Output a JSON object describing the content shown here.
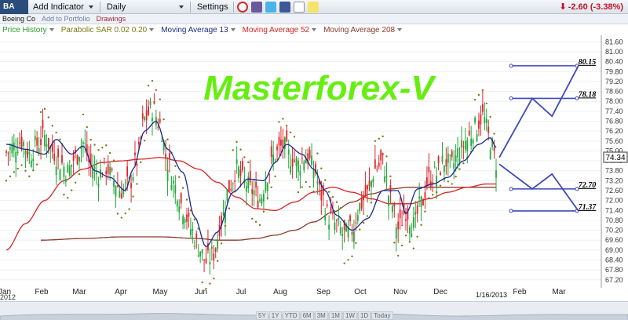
{
  "toolbar": {
    "symbol": "BA",
    "add_indicator": "Add Indicator",
    "interval": "Daily",
    "settings": "Settings",
    "change": "-2.60 (-3.38%)",
    "change_color": "#c0152a",
    "icons": [
      "alarm-clock-icon",
      "document-icon",
      "twitter-icon",
      "facebook-icon",
      "email-icon",
      "note-icon"
    ]
  },
  "subbar": {
    "company": "Boeing Co",
    "add_portfolio": "Add to Portfolio",
    "drawings": "Drawings"
  },
  "legend": [
    {
      "label": "Price History",
      "color": "#2a9a2a"
    },
    {
      "label": "Parabolic SAR 0.02 0.20",
      "color": "#7a7a14"
    },
    {
      "label": "Moving Average 13",
      "color": "#1a2a8a"
    },
    {
      "label": "Moving Average 52",
      "color": "#d62222"
    },
    {
      "label": "Moving Average 208",
      "color": "#8a3a2a"
    }
  ],
  "chart_data": {
    "type": "line",
    "title": "Masterforex-V",
    "title_color": "#66ee11",
    "x_ticks": [
      "Jan",
      "Feb",
      "Mar",
      "Apr",
      "May",
      "Jun",
      "Jul",
      "Aug",
      "Sep",
      "Oct",
      "Nov",
      "Dec",
      "Feb",
      "Mar"
    ],
    "x_year_label": "2012",
    "date_label": "1/16/2013",
    "y_ticks": [
      "81.60",
      "81.00",
      "80.40",
      "79.80",
      "79.20",
      "78.60",
      "78.00",
      "77.40",
      "76.80",
      "76.20",
      "75.60",
      "75.00",
      "74.40",
      "73.80",
      "73.20",
      "72.60",
      "72.00",
      "71.40",
      "70.80",
      "70.20",
      "69.60",
      "69.00",
      "68.40",
      "67.80",
      "67.20"
    ],
    "ylim": [
      67.0,
      81.9
    ],
    "last_price": "74.34",
    "levels": [
      {
        "value": 80.15,
        "label": "80.15"
      },
      {
        "value": 78.18,
        "label": "78.18"
      },
      {
        "value": 72.7,
        "label": "72.70"
      },
      {
        "value": 71.37,
        "label": "71.37"
      }
    ],
    "price_anchors": [
      [
        0,
        74.9
      ],
      [
        4,
        75.3
      ],
      [
        8,
        75.6
      ],
      [
        12,
        74.8
      ],
      [
        16,
        75.4
      ],
      [
        20,
        75.9
      ],
      [
        24,
        75.0
      ],
      [
        28,
        74.3
      ],
      [
        32,
        73.8
      ],
      [
        36,
        74.6
      ],
      [
        40,
        75.5
      ],
      [
        44,
        74.1
      ],
      [
        48,
        73.6
      ],
      [
        52,
        74.0
      ],
      [
        56,
        73.2
      ],
      [
        60,
        72.6
      ],
      [
        64,
        73.0
      ],
      [
        68,
        74.4
      ],
      [
        72,
        76.9
      ],
      [
        76,
        77.6
      ],
      [
        80,
        76.6
      ],
      [
        84,
        74.3
      ],
      [
        88,
        72.8
      ],
      [
        92,
        71.6
      ],
      [
        96,
        70.3
      ],
      [
        100,
        69.2
      ],
      [
        104,
        68.3
      ],
      [
        108,
        68.8
      ],
      [
        112,
        70.8
      ],
      [
        116,
        72.8
      ],
      [
        120,
        73.9
      ],
      [
        124,
        73.1
      ],
      [
        128,
        72.6
      ],
      [
        132,
        72.1
      ],
      [
        136,
        73.6
      ],
      [
        140,
        74.8
      ],
      [
        144,
        75.3
      ],
      [
        148,
        74.6
      ],
      [
        152,
        74.2
      ],
      [
        156,
        74.7
      ],
      [
        160,
        74.0
      ],
      [
        164,
        72.3
      ],
      [
        168,
        71.0
      ],
      [
        172,
        70.5
      ],
      [
        176,
        69.9
      ],
      [
        180,
        70.2
      ],
      [
        184,
        71.7
      ],
      [
        188,
        72.4
      ],
      [
        192,
        73.9
      ],
      [
        196,
        74.3
      ],
      [
        200,
        72.0
      ],
      [
        204,
        70.3
      ],
      [
        208,
        71.4
      ],
      [
        212,
        70.5
      ],
      [
        216,
        71.8
      ],
      [
        220,
        73.3
      ],
      [
        224,
        73.6
      ],
      [
        228,
        74.4
      ],
      [
        232,
        74.1
      ],
      [
        236,
        75.0
      ],
      [
        240,
        75.7
      ],
      [
        244,
        76.4
      ],
      [
        248,
        77.1
      ],
      [
        252,
        75.6
      ],
      [
        255,
        74.3
      ]
    ],
    "ma13_anchors": [
      [
        0,
        75.4
      ],
      [
        10,
        75.1
      ],
      [
        20,
        74.8
      ],
      [
        26,
        75.7
      ],
      [
        34,
        74.8
      ],
      [
        40,
        75.3
      ],
      [
        46,
        73.8
      ],
      [
        54,
        73.4
      ],
      [
        62,
        72.6
      ],
      [
        66,
        73.9
      ],
      [
        72,
        76.2
      ],
      [
        78,
        76.8
      ],
      [
        84,
        75.1
      ],
      [
        92,
        73.7
      ],
      [
        98,
        71.0
      ],
      [
        104,
        69.2
      ],
      [
        110,
        70.1
      ],
      [
        118,
        72.5
      ],
      [
        126,
        73.3
      ],
      [
        134,
        73.2
      ],
      [
        140,
        74.3
      ],
      [
        146,
        75.4
      ],
      [
        154,
        74.8
      ],
      [
        160,
        73.9
      ],
      [
        166,
        72.6
      ],
      [
        172,
        71.1
      ],
      [
        180,
        70.2
      ],
      [
        188,
        70.9
      ],
      [
        196,
        72.6
      ],
      [
        204,
        72.6
      ],
      [
        208,
        71.2
      ],
      [
        214,
        72.7
      ],
      [
        222,
        73.0
      ],
      [
        230,
        73.4
      ],
      [
        238,
        74.4
      ],
      [
        246,
        75.4
      ],
      [
        252,
        75.8
      ],
      [
        255,
        75.2
      ]
    ],
    "ma52_anchors": [
      [
        0,
        69.0
      ],
      [
        10,
        70.6
      ],
      [
        20,
        72.0
      ],
      [
        30,
        73.2
      ],
      [
        40,
        73.9
      ],
      [
        50,
        74.3
      ],
      [
        60,
        74.4
      ],
      [
        70,
        74.5
      ],
      [
        80,
        74.6
      ],
      [
        90,
        74.4
      ],
      [
        100,
        73.9
      ],
      [
        110,
        73.1
      ],
      [
        120,
        72.2
      ],
      [
        130,
        71.5
      ],
      [
        140,
        71.4
      ],
      [
        150,
        71.9
      ],
      [
        160,
        72.5
      ],
      [
        170,
        72.8
      ],
      [
        180,
        72.5
      ],
      [
        190,
        72.1
      ],
      [
        200,
        71.8
      ],
      [
        210,
        71.8
      ],
      [
        220,
        72.1
      ],
      [
        230,
        72.5
      ],
      [
        240,
        72.8
      ],
      [
        250,
        73.0
      ],
      [
        255,
        73.0
      ]
    ],
    "ma208_anchors": [
      [
        18,
        69.6
      ],
      [
        40,
        69.7
      ],
      [
        60,
        69.8
      ],
      [
        80,
        69.8
      ],
      [
        100,
        69.7
      ],
      [
        110,
        69.6
      ],
      [
        120,
        69.6
      ],
      [
        130,
        69.7
      ],
      [
        140,
        69.9
      ],
      [
        150,
        70.2
      ],
      [
        160,
        70.7
      ],
      [
        170,
        71.3
      ],
      [
        180,
        71.9
      ],
      [
        190,
        72.4
      ],
      [
        200,
        72.7
      ],
      [
        210,
        72.8
      ],
      [
        220,
        72.8
      ],
      [
        230,
        72.8
      ],
      [
        240,
        72.8
      ],
      [
        255,
        72.8
      ]
    ],
    "projection_up": [
      [
        0,
        74.6
      ],
      [
        1.0,
        78.18
      ],
      [
        1.6,
        77.1
      ],
      [
        2.4,
        80.15
      ]
    ],
    "projection_down": [
      [
        0,
        74.2
      ],
      [
        1.0,
        72.7
      ],
      [
        1.6,
        73.6
      ],
      [
        2.4,
        71.37
      ]
    ]
  }
}
